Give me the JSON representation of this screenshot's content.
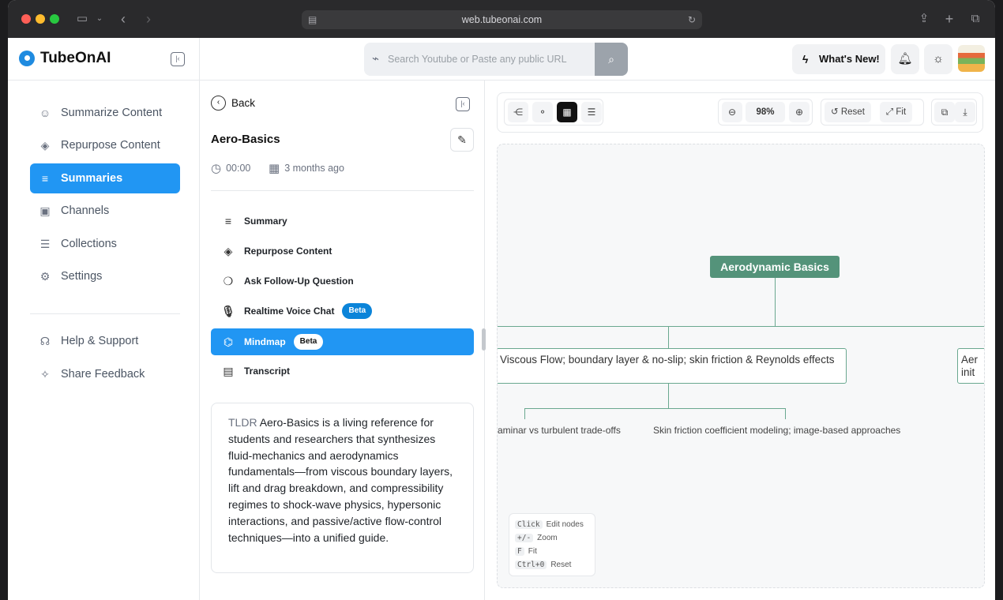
{
  "browser": {
    "url": "web.tubeonai.com"
  },
  "app": {
    "logo_text": "TubeOnAI",
    "search_placeholder": "Search Youtube or Paste any public URL",
    "whats_new": "What's New!"
  },
  "sidebar": {
    "items": [
      {
        "label": "Summarize Content",
        "icon": "robot-icon"
      },
      {
        "label": "Repurpose Content",
        "icon": "layers-icon"
      },
      {
        "label": "Summaries",
        "icon": "lines-icon",
        "active": true
      },
      {
        "label": "Channels",
        "icon": "tv-icon"
      },
      {
        "label": "Collections",
        "icon": "list-icon"
      },
      {
        "label": "Settings",
        "icon": "gear-icon"
      }
    ],
    "footer_items": [
      {
        "label": "Help & Support",
        "icon": "headset-icon"
      },
      {
        "label": "Share Feedback",
        "icon": "sparkle-icon"
      }
    ]
  },
  "detail": {
    "back_label": "Back",
    "title": "Aero-Basics",
    "duration": "00:00",
    "date": "3 months ago",
    "menu": [
      {
        "label": "Summary",
        "icon": "summary-icon"
      },
      {
        "label": "Repurpose Content",
        "icon": "layers-icon"
      },
      {
        "label": "Ask Follow-Up Question",
        "icon": "chat-icon"
      },
      {
        "label": "Realtime Voice Chat",
        "icon": "mic-icon",
        "badge": "Beta"
      },
      {
        "label": "Mindmap",
        "icon": "mindmap-icon",
        "badge": "Beta",
        "active": true
      },
      {
        "label": "Transcript",
        "icon": "transcript-icon"
      }
    ],
    "tldr_label": "TLDR",
    "tldr_text": "Aero-Basics is a living reference for students and researchers that synthesizes fluid-mechanics and aerodynamics fundamentals—from viscous boundary layers, lift and drag breakdown, and compressibility regimes to shock-wave physics, hypersonic interactions, and passive/active flow-control techniques—into a unified guide."
  },
  "mindmap": {
    "zoom": "98%",
    "reset_label": "Reset",
    "fit_label": "Fit",
    "root": "Aerodynamic Basics",
    "child_1": "Viscous Flow; boundary layer & no-slip; skin friction & Reynolds effects",
    "child_2": "Aer init",
    "leaf_1": "aminar vs turbulent trade-offs",
    "leaf_2": "Skin friction coefficient modeling; image-based approaches",
    "legend": [
      {
        "key": "Click",
        "desc": "Edit nodes"
      },
      {
        "key": "+/-",
        "desc": "Zoom"
      },
      {
        "key": "F",
        "desc": "Fit"
      },
      {
        "key": "Ctrl+0",
        "desc": "Reset"
      }
    ]
  }
}
